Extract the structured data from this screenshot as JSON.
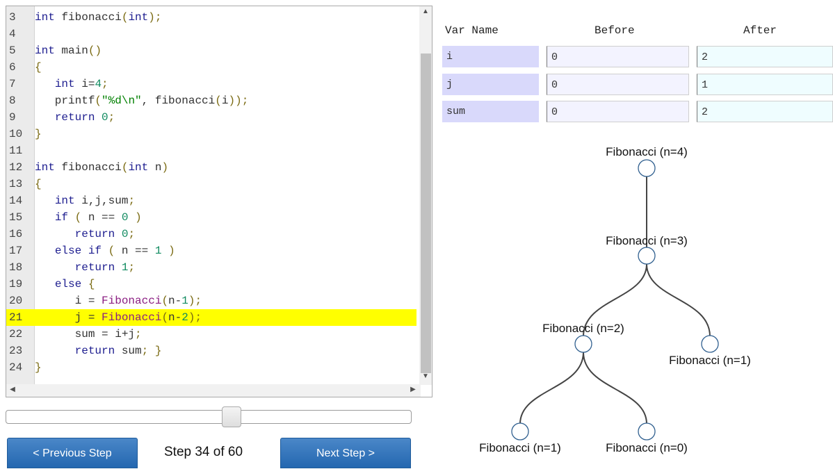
{
  "code": {
    "lines": [
      {
        "n": "3",
        "t": "int fibonacci(int);"
      },
      {
        "n": "4",
        "t": ""
      },
      {
        "n": "5",
        "t": "int main()"
      },
      {
        "n": "6",
        "t": "{"
      },
      {
        "n": "7",
        "t": "   int i=4;"
      },
      {
        "n": "8",
        "t": "   printf(\"%d\\n\", fibonacci(i));"
      },
      {
        "n": "9",
        "t": "   return 0;"
      },
      {
        "n": "10",
        "t": "}"
      },
      {
        "n": "11",
        "t": ""
      },
      {
        "n": "12",
        "t": "int fibonacci(int n)"
      },
      {
        "n": "13",
        "t": "{"
      },
      {
        "n": "14",
        "t": "   int i,j,sum;"
      },
      {
        "n": "15",
        "t": "   if ( n == 0 )"
      },
      {
        "n": "16",
        "t": "      return 0;"
      },
      {
        "n": "17",
        "t": "   else if ( n == 1 )"
      },
      {
        "n": "18",
        "t": "      return 1;"
      },
      {
        "n": "19",
        "t": "   else {"
      },
      {
        "n": "20",
        "t": "      i = Fibonacci(n-1);"
      },
      {
        "n": "21",
        "t": "      j = Fibonacci(n-2);"
      },
      {
        "n": "22",
        "t": "      sum = i+j;"
      },
      {
        "n": "23",
        "t": "      return sum; }"
      },
      {
        "n": "24",
        "t": "}"
      }
    ],
    "highlight_line": "21",
    "highlight_color": "#ffff00"
  },
  "controls": {
    "prev_label": "< Previous Step",
    "next_label": "Next Step >",
    "step_text": "Step 34 of 60",
    "slider_progress": 0.5593
  },
  "vars": {
    "headers": {
      "name": "Var Name",
      "before": "Before",
      "after": "After"
    },
    "rows": [
      {
        "name": "i",
        "before": "0",
        "after": "2"
      },
      {
        "name": "j",
        "before": "0",
        "after": "1"
      },
      {
        "name": "sum",
        "before": "0",
        "after": "2"
      }
    ]
  },
  "tree": {
    "nodes": [
      {
        "label": "Fibonacci (n=4)"
      },
      {
        "label": "Fibonacci (n=3)"
      },
      {
        "label": "Fibonacci (n=2)"
      },
      {
        "label": "Fibonacci (n=1)"
      },
      {
        "label": "Fibonacci (n=1)"
      },
      {
        "label": "Fibonacci (n=0)"
      }
    ]
  },
  "colors": {
    "button": "#2a6db5",
    "var_name_bg": "#d9d9fb",
    "before_bg": "#f3f3ff",
    "after_bg": "#effdff"
  }
}
